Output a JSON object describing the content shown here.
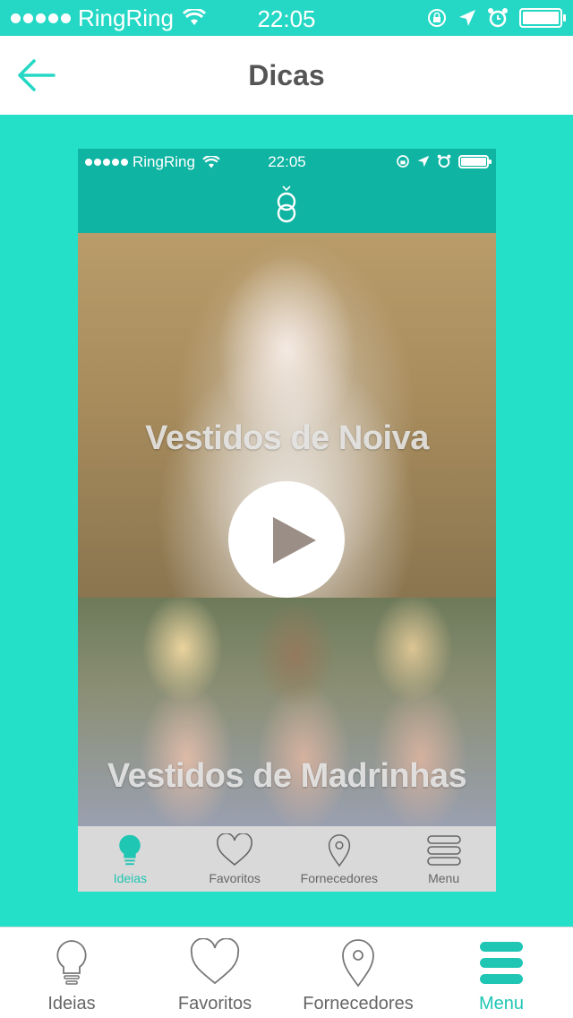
{
  "status_bar": {
    "carrier": "RingRing",
    "time": "22:05"
  },
  "header": {
    "title": "Dicas"
  },
  "preview": {
    "status_bar": {
      "carrier": "RingRing",
      "time": "22:05"
    },
    "cards": [
      {
        "title": "Vestidos de Noiva"
      },
      {
        "title": "Vestidos de Madrinhas"
      }
    ],
    "tabs": [
      {
        "label": "Ideias",
        "icon": "lightbulb-icon",
        "active": true
      },
      {
        "label": "Favoritos",
        "icon": "heart-icon"
      },
      {
        "label": "Fornecedores",
        "icon": "location-pin-icon"
      },
      {
        "label": "Menu",
        "icon": "menu-icon"
      }
    ]
  },
  "tabbar": {
    "tabs": [
      {
        "label": "Ideias",
        "icon": "lightbulb-icon"
      },
      {
        "label": "Favoritos",
        "icon": "heart-icon"
      },
      {
        "label": "Fornecedores",
        "icon": "location-pin-icon"
      },
      {
        "label": "Menu",
        "icon": "menu-icon",
        "active": true
      }
    ]
  },
  "colors": {
    "accent": "#25e0c8",
    "header_teal": "#0fb4a2",
    "active_tab": "#1fc6b3"
  }
}
